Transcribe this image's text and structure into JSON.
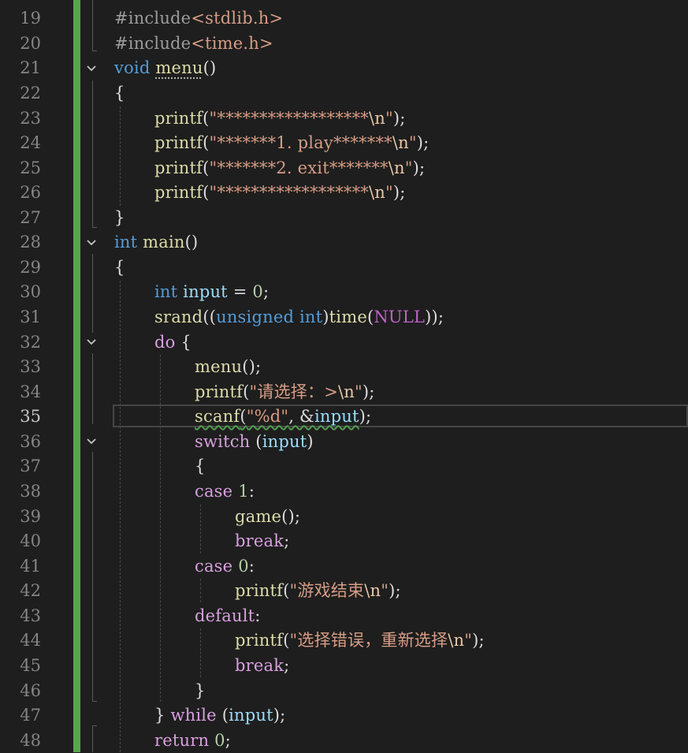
{
  "editor": {
    "active_line": "35",
    "line_numbers": [
      "19",
      "20",
      "21",
      "22",
      "23",
      "24",
      "25",
      "26",
      "27",
      "28",
      "29",
      "30",
      "31",
      "32",
      "33",
      "34",
      "35",
      "36",
      "37",
      "38",
      "39",
      "40",
      "41",
      "42",
      "43",
      "44",
      "45",
      "46",
      "47",
      "48"
    ],
    "code": {
      "l19": {
        "a": "#include",
        "b": "<stdlib.h>"
      },
      "l20": {
        "a": "#include",
        "b": "<time.h>"
      },
      "l21": {
        "a": "void",
        "b": " ",
        "c": "menu",
        "d": "()"
      },
      "l22": {
        "a": "{"
      },
      "l23": {
        "a": "printf",
        "b": "(",
        "c": "\"******************",
        "d": "\\n",
        "e": "\"",
        "f": ");"
      },
      "l24": {
        "a": "printf",
        "b": "(",
        "c": "\"*******1. play*******",
        "d": "\\n",
        "e": "\"",
        "f": ");"
      },
      "l25": {
        "a": "printf",
        "b": "(",
        "c": "\"*******2. exit*******",
        "d": "\\n",
        "e": "\"",
        "f": ");"
      },
      "l26": {
        "a": "printf",
        "b": "(",
        "c": "\"******************",
        "d": "\\n",
        "e": "\"",
        "f": ");"
      },
      "l27": {
        "a": "}"
      },
      "l28": {
        "a": "int",
        "b": " ",
        "c": "main",
        "d": "()"
      },
      "l29": {
        "a": "{"
      },
      "l30": {
        "a": "int",
        "b": " ",
        "c": "input",
        "d": " = ",
        "e": "0",
        "f": ";"
      },
      "l31": {
        "a": "srand",
        "b": "((",
        "c": "unsigned int",
        "d": ")",
        "e": "time",
        "f": "(",
        "g": "NULL",
        "h": "));"
      },
      "l32": {
        "a": "do",
        "b": " {"
      },
      "l33": {
        "a": "menu",
        "b": "();"
      },
      "l34": {
        "a": "printf",
        "b": "(",
        "c": "\"请选择：>",
        "d": "\\n",
        "e": "\"",
        "f": ");"
      },
      "l35": {
        "a": "scanf",
        "b": "(",
        "c": "\"%d\"",
        "d": ", &",
        "e": "input",
        "f": ");"
      },
      "l36": {
        "a": "switch",
        "b": " (",
        "c": "input",
        "d": ")"
      },
      "l37": {
        "a": "{"
      },
      "l38": {
        "a": "case",
        "b": " ",
        "c": "1",
        "d": ":"
      },
      "l39": {
        "a": "game",
        "b": "();"
      },
      "l40": {
        "a": "break",
        "b": ";"
      },
      "l41": {
        "a": "case",
        "b": " ",
        "c": "0",
        "d": ":"
      },
      "l42": {
        "a": "printf",
        "b": "(",
        "c": "\"游戏结束",
        "d": "\\n",
        "e": "\"",
        "f": ");"
      },
      "l43": {
        "a": "default",
        "b": ":"
      },
      "l44": {
        "a": "printf",
        "b": "(",
        "c": "\"选择错误，重新选择",
        "d": "\\n",
        "e": "\"",
        "f": ");"
      },
      "l45": {
        "a": "break",
        "b": ";"
      },
      "l46": {
        "a": "}"
      },
      "l47": {
        "a": "} ",
        "b": "while",
        "c": " (",
        "d": "input",
        "e": ");"
      },
      "l48": {
        "a": "return",
        "b": " ",
        "c": "0",
        "d": ";"
      }
    },
    "colors": {
      "background": "#1e1e1e",
      "change_bar": "#57a64a",
      "keyword": "#569cd6",
      "control": "#d8a0df",
      "function": "#dcdcaa",
      "string": "#d69d85",
      "number": "#b5cea8",
      "variable": "#9cdcfe"
    }
  }
}
